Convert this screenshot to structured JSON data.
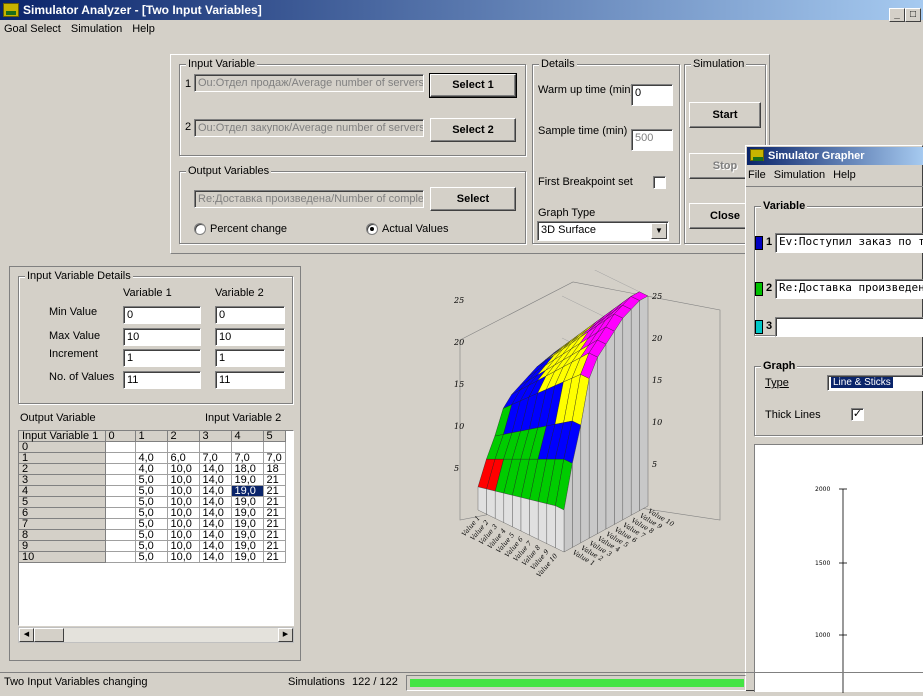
{
  "window": {
    "title": "Simulator Analyzer - [Two Input Variables]",
    "buttons": [
      "_",
      "□",
      "×"
    ]
  },
  "menu": [
    "Goal Select",
    "Simulation",
    "Help"
  ],
  "input_variable": {
    "group_label": "Input Variable",
    "row1_index": "1",
    "row1_value": "Ou:Отдел продаж/Average number of servers avail",
    "row1_button": "Select 1",
    "row2_index": "2",
    "row2_value": "Ou:Отдел закупок/Average number of servers avai",
    "row2_button": "Select 2"
  },
  "output_variables": {
    "group_label": "Output Variables",
    "value": "Re:Доставка произведена/Number of completed j",
    "button": "Select",
    "radio_percent": "Percent change",
    "radio_actual": "Actual Values"
  },
  "details": {
    "group_label": "Details",
    "warmup_label": "Warm up time (min)",
    "warmup_value": "0",
    "sample_label": "Sample time (min)",
    "sample_value": "500",
    "breakpoint_label": "First Breakpoint set",
    "graph_type_label": "Graph Type",
    "graph_type_value": "3D Surface"
  },
  "simulation": {
    "group_label": "Simulation",
    "start": "Start",
    "stop": "Stop",
    "close": "Close"
  },
  "input_details": {
    "group_label": "Input Variable Details",
    "col1": "Variable 1",
    "col2": "Variable 2",
    "rows": [
      {
        "label": "Min Value",
        "v1": "0",
        "v2": "0"
      },
      {
        "label": "Max Value",
        "v1": "10",
        "v2": "10"
      },
      {
        "label": "Increment",
        "v1": "1",
        "v2": "1"
      },
      {
        "label": "No. of Values",
        "v1": "11",
        "v2": "11"
      }
    ]
  },
  "output_grid": {
    "left_label": "Output Variable",
    "right_label": "Input Variable 2",
    "headers": [
      "Input Variable 1",
      "0",
      "1",
      "2",
      "3",
      "4",
      "5"
    ],
    "rows": [
      [
        "0",
        "",
        "",
        "",
        "",
        "",
        ""
      ],
      [
        "1",
        "",
        "4,0",
        "6,0",
        "7,0",
        "7,0",
        "7,0"
      ],
      [
        "2",
        "",
        "4,0",
        "10,0",
        "14,0",
        "18,0",
        "18"
      ],
      [
        "3",
        "",
        "5,0",
        "10,0",
        "14,0",
        "19,0",
        "21"
      ],
      [
        "4",
        "",
        "5,0",
        "10,0",
        "14,0",
        "19,0",
        "21"
      ],
      [
        "5",
        "",
        "5,0",
        "10,0",
        "14,0",
        "19,0",
        "21"
      ],
      [
        "6",
        "",
        "5,0",
        "10,0",
        "14,0",
        "19,0",
        "21"
      ],
      [
        "7",
        "",
        "5,0",
        "10,0",
        "14,0",
        "19,0",
        "21"
      ],
      [
        "8",
        "",
        "5,0",
        "10,0",
        "14,0",
        "19,0",
        "21"
      ],
      [
        "9",
        "",
        "5,0",
        "10,0",
        "14,0",
        "19,0",
        "21"
      ],
      [
        "10",
        "",
        "5,0",
        "10,0",
        "14,0",
        "19,0",
        "21"
      ]
    ]
  },
  "chart_data": {
    "type": "surface-3d",
    "z_ticks": [
      "5",
      "10",
      "15",
      "20",
      "25"
    ],
    "x_labels": [
      "Value 1",
      "Value 2",
      "Value 3",
      "Value 4",
      "Value 5",
      "Value 6",
      "Value 7",
      "Value 8",
      "Value 9",
      "Value 10"
    ],
    "y_labels": [
      "Value 1",
      "Value 2",
      "Value 3",
      "Value 4",
      "Value 5",
      "Value 6",
      "Value 7",
      "Value 8",
      "Value 9",
      "Value 10"
    ],
    "band_colors": [
      "#ff0000",
      "#00cc00",
      "#0000ff",
      "#ffff00",
      "#ff00ff",
      "#ff00ff"
    ],
    "zlim": [
      0,
      25
    ]
  },
  "grapher": {
    "title": "Simulator Grapher",
    "menu": [
      "File",
      "Simulation",
      "Help"
    ],
    "variable_label": "Variable",
    "var1_index": "1",
    "var1_value": "Ev:Поступил заказ по тел",
    "var1_color": "#0000c0",
    "var2_index": "2",
    "var2_value": "Re:Доставка произведена",
    "var2_color": "#00c000",
    "var3_index": "3",
    "var3_value": "",
    "var3_color": "#00c8c8",
    "graph_label": "Graph",
    "type_label": "Type",
    "type_value": "Line & Sticks",
    "thick_lines_label": "Thick Lines",
    "y_ticks": [
      "2000",
      "1500",
      "1000"
    ]
  },
  "status": {
    "left": "Two Input Variables changing",
    "sim_label": "Simulations",
    "sim_count": "122 / 122",
    "progress": 1.0
  }
}
